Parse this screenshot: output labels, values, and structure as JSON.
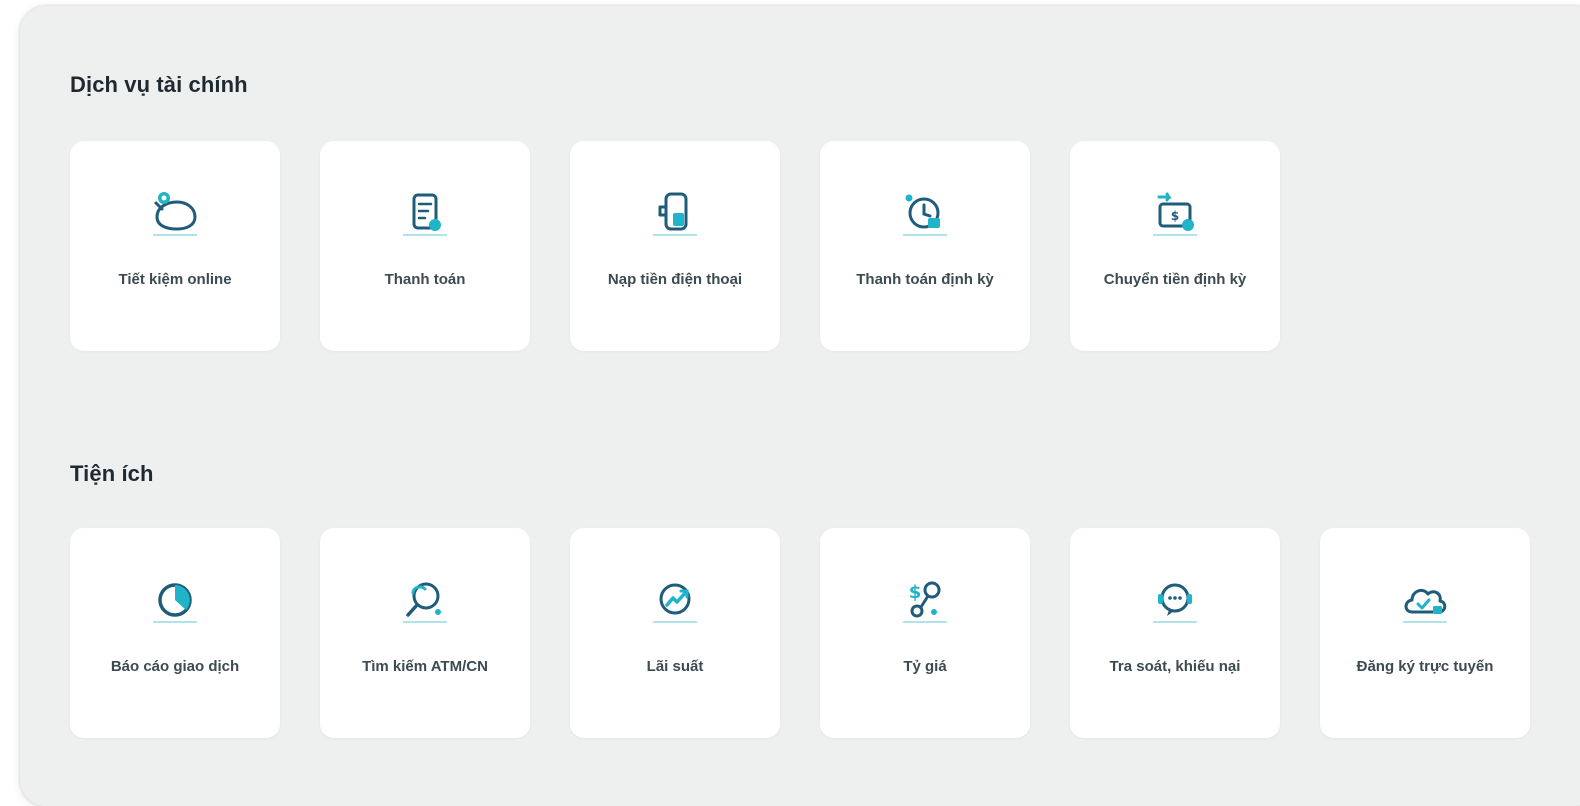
{
  "colors": {
    "panel_bg": "#eef0f0",
    "tile_bg": "#ffffff",
    "icon_dark": "#1f5c7a",
    "icon_accent": "#1fb4c9",
    "title_text": "#1f2a30",
    "label_text": "#3c4a52"
  },
  "sections": [
    {
      "title": "Dịch vụ tài chính",
      "items": [
        {
          "label": "Tiết kiệm online",
          "icon": "piggy-bank-icon"
        },
        {
          "label": "Thanh toán",
          "icon": "bill-document-icon"
        },
        {
          "label": "Nạp tiền điện thoại",
          "icon": "phone-topup-icon"
        },
        {
          "label": "Thanh toán định kỳ",
          "icon": "clock-payment-icon"
        },
        {
          "label": "Chuyển tiền định kỳ",
          "icon": "money-transfer-icon"
        }
      ]
    },
    {
      "title": "Tiện ích",
      "items": [
        {
          "label": "Báo cáo giao dịch",
          "icon": "pie-chart-icon"
        },
        {
          "label": "Tìm kiếm ATM/CN",
          "icon": "search-atm-icon"
        },
        {
          "label": "Lãi suất",
          "icon": "interest-rate-icon"
        },
        {
          "label": "Tỷ giá",
          "icon": "exchange-rate-icon"
        },
        {
          "label": "Tra soát, khiếu nại",
          "icon": "support-chat-icon"
        },
        {
          "label": "Đăng ký trực tuyến",
          "icon": "cloud-register-icon"
        }
      ]
    }
  ]
}
